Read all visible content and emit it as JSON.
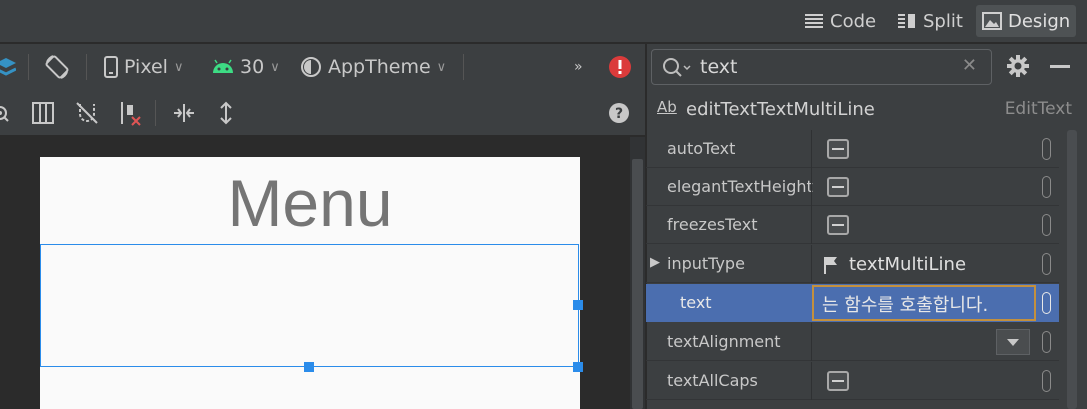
{
  "view_modes": [
    {
      "label": "Code",
      "icon": "code-lines-icon",
      "active": false
    },
    {
      "label": "Split",
      "icon": "split-view-icon",
      "active": false
    },
    {
      "label": "Design",
      "icon": "image-icon",
      "active": true
    }
  ],
  "toolbar": {
    "device": "Pixel",
    "api_level": "30",
    "theme": "AppTheme",
    "overflow": "»"
  },
  "canvas": {
    "title_text": "Menu"
  },
  "attributes": {
    "search_value": "text",
    "component_name": "editTextTextMultiLine",
    "component_type": "EditText",
    "component_icon_text": "Ab",
    "rows": [
      {
        "name": "autoText",
        "kind": "checkbox"
      },
      {
        "name": "elegantTextHeight",
        "kind": "checkbox"
      },
      {
        "name": "freezesText",
        "kind": "checkbox"
      },
      {
        "name": "inputType",
        "kind": "flag",
        "value": "textMultiLine",
        "expandable": true
      },
      {
        "name": "text",
        "kind": "text-editing",
        "value": "는 함수를 호출합니다."
      },
      {
        "name": "textAlignment",
        "kind": "dropdown"
      },
      {
        "name": "textAllCaps",
        "kind": "checkbox"
      }
    ]
  },
  "colors": {
    "selection_blue": "#2b8cea",
    "selected_row": "#4b6eaf",
    "edit_border": "#c3903e",
    "error_red": "#db3b3b",
    "android_green": "#3ddc84"
  }
}
